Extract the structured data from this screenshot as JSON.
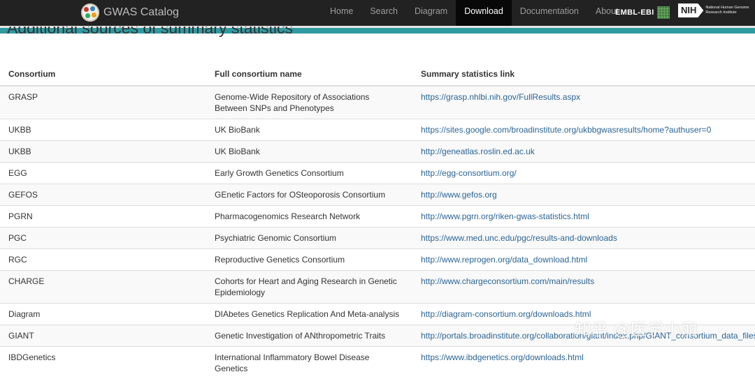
{
  "navbar": {
    "brand": "GWAS Catalog",
    "items": [
      "Home",
      "Search",
      "Diagram",
      "Download",
      "Documentation",
      "About"
    ],
    "active": "Download",
    "ebi_label": "EMBL-EBI",
    "nih_label": "NIH",
    "nih_subtext": "National Human Genome Research Institute",
    "accent_color": "#2f9aa0"
  },
  "section_title": "Additional sources of summary statistics",
  "table": {
    "headers": [
      "Consortium",
      "Full consortium name",
      "Summary statistics link"
    ],
    "rows": [
      [
        "GRASP",
        "Genome-Wide Repository of Associations Between SNPs and Phenotypes",
        "https://grasp.nhlbi.nih.gov/FullResults.aspx"
      ],
      [
        "UKBB",
        "UK BioBank",
        "https://sites.google.com/broadinstitute.org/ukbbgwasresults/home?authuser=0"
      ],
      [
        "UKBB",
        "UK BioBank",
        "http://geneatlas.roslin.ed.ac.uk"
      ],
      [
        "EGG",
        "Early Growth Genetics Consortium",
        "http://egg-consortium.org/"
      ],
      [
        "GEFOS",
        "GEnetic Factors for OSteoporosis Consortium",
        "http://www.gefos.org"
      ],
      [
        "PGRN",
        "Pharmacogenomics Research Network",
        "http://www.pgrn.org/riken-gwas-statistics.html"
      ],
      [
        "PGC",
        "Psychiatric Genomic Consortium",
        "https://www.med.unc.edu/pgc/results-and-downloads"
      ],
      [
        "RGC",
        "Reproductive Genetics Consortium",
        "http://www.reprogen.org/data_download.html"
      ],
      [
        "CHARGE",
        "Cohorts for Heart and Aging Research in Genetic Epidemiology",
        "http://www.chargeconsortium.com/main/results"
      ],
      [
        "Diagram",
        "DIAbetes Genetics Replication And Meta-analysis",
        "http://diagram-consortium.org/downloads.html"
      ],
      [
        "GIANT",
        "Genetic Investigation of ANthropometric Traits",
        "http://portals.broadinstitute.org/collaboration/giant/index.php/GIANT_consortium_data_files"
      ],
      [
        "IBDGenetics",
        "International Inflammatory Bowel Disease Genetics",
        "https://www.ibdgenetics.org/downloads.html"
      ]
    ]
  },
  "watermark": "知乎 @医学小丽"
}
